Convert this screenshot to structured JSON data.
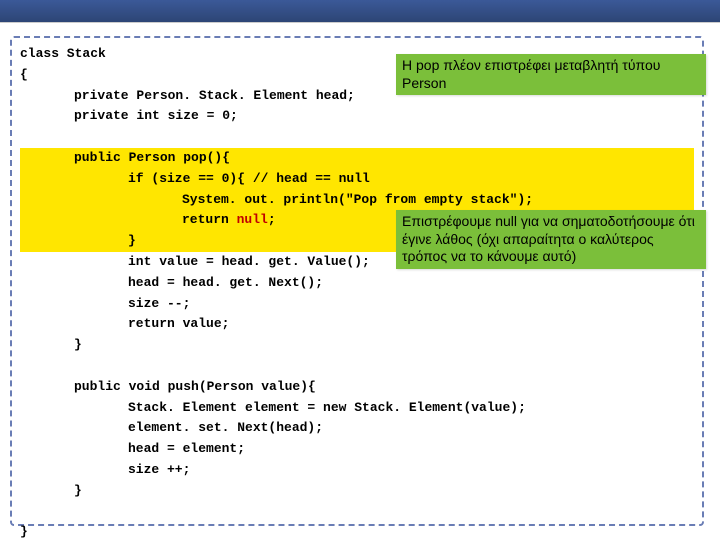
{
  "code": {
    "l1": "class Stack",
    "l2": "{",
    "l3": "private Person. Stack. Element head;",
    "l4": "private int size = 0;",
    "l5": "public Person pop(){",
    "l6": "if (size == 0){ // head == null",
    "l7": "System. out. println(\"Pop from empty stack\");",
    "l8a": "return ",
    "l8b": "null",
    "l8c": ";",
    "l9": "}",
    "l10": "int value = head. get. Value();",
    "l11": "head = head. get. Next();",
    "l12": "size --;",
    "l13": "return value;",
    "l14": "}",
    "l15": "public void push(Person value){",
    "l16": "Stack. Element element = new Stack. Element(value);",
    "l17": "element. set. Next(head);",
    "l18": "head = element;",
    "l19": "size ++;",
    "l20": "}",
    "l21": "}"
  },
  "callouts": {
    "c1": "H pop πλέον επιστρέφει μεταβλητή τύπου Person",
    "c2": "Επιστρέφουμε null για να σηματοδοτήσουμε ότι έγινε λάθος (όχι απαραίτητα ο καλύτερος τρόπος να το κάνουμε αυτό)"
  }
}
